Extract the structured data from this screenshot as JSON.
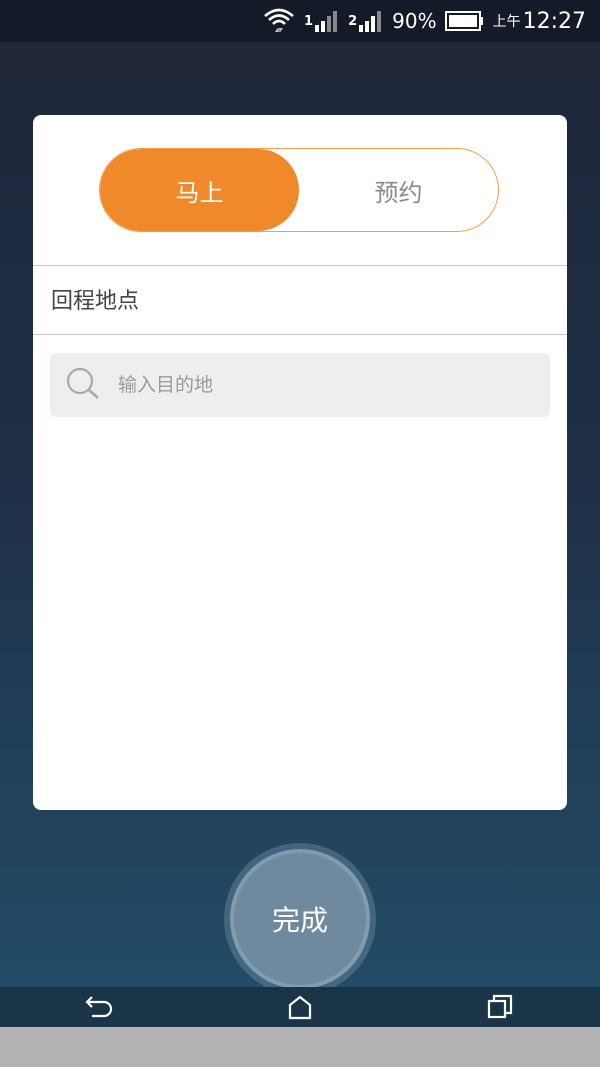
{
  "status_bar": {
    "sim1_label": "1",
    "sim2_label": "2",
    "battery_percent": "90%",
    "time_prefix": "上午",
    "time": "12:27",
    "icons": [
      "wifi-icon",
      "signal-icon",
      "battery-icon"
    ]
  },
  "toggle": {
    "now_label": "马上",
    "reserve_label": "预约",
    "selected": "now",
    "active_color": "#f0892a"
  },
  "section": {
    "label": "回程地点"
  },
  "search": {
    "placeholder": "输入目的地",
    "value": "",
    "icon": "search-icon"
  },
  "done_button": {
    "label": "完成"
  },
  "nav_bar": {
    "icons": [
      "back-icon",
      "home-icon",
      "recents-icon"
    ]
  }
}
